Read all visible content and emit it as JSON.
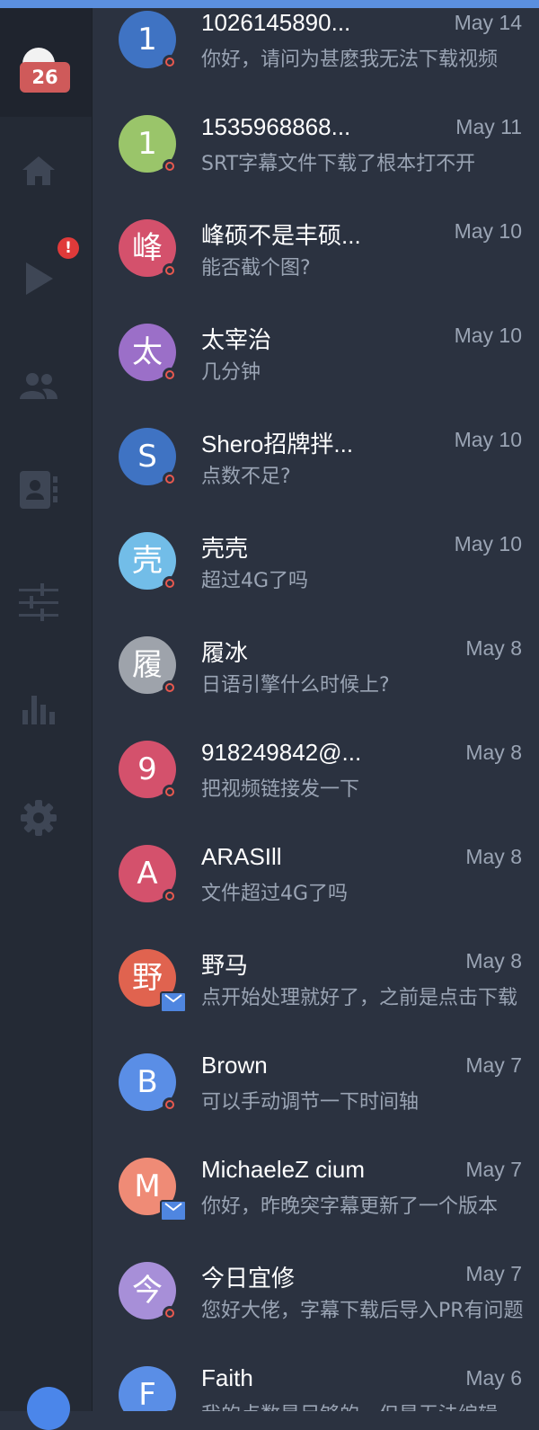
{
  "sidebar": {
    "unread_badge": "26",
    "alert_badge": "!",
    "nav_items": [
      {
        "icon": "home-icon"
      },
      {
        "icon": "play-icon"
      },
      {
        "icon": "people-icon"
      },
      {
        "icon": "contacts-icon"
      },
      {
        "icon": "sliders-icon"
      },
      {
        "icon": "bar-chart-icon"
      },
      {
        "icon": "gear-icon"
      }
    ]
  },
  "colors": {
    "accent": "#5b8fdf",
    "badge": "#cf5a5a",
    "alert": "#e03a3a",
    "status_ring": "#e8594f"
  },
  "conversations": [
    {
      "initial": "1",
      "name": "1026145890...",
      "date": "May 14",
      "message": "你好，请问为甚麽我无法下载视频",
      "avatar_color": "#3f73c3",
      "status": "ring"
    },
    {
      "initial": "1",
      "name": "1535968868...",
      "date": "May 11",
      "message": "SRT字幕文件下载了根本打不开",
      "avatar_color": "#9ac56a",
      "status": "ring"
    },
    {
      "initial": "峰",
      "name": "峰硕不是丰硕...",
      "date": "May 10",
      "message": "能否截个图?",
      "avatar_color": "#d4516c",
      "status": "ring"
    },
    {
      "initial": "太",
      "name": "太宰治",
      "date": "May 10",
      "message": "几分钟",
      "avatar_color": "#9b6fc8",
      "status": "ring"
    },
    {
      "initial": "S",
      "name": "Shero招牌拌...",
      "date": "May 10",
      "message": "点数不足?",
      "avatar_color": "#3f73c3",
      "status": "ring"
    },
    {
      "initial": "壳",
      "name": "壳壳",
      "date": "May 10",
      "message": "超过4G了吗",
      "avatar_color": "#72bde8",
      "status": "ring"
    },
    {
      "initial": "履",
      "name": "履冰",
      "date": "May 8",
      "message": "日语引擎什么时候上?",
      "avatar_color": "#9ea3ab",
      "status": "ring"
    },
    {
      "initial": "9",
      "name": "918249842@...",
      "date": "May 8",
      "message": "把视频链接发一下",
      "avatar_color": "#d4516c",
      "status": "ring"
    },
    {
      "initial": "A",
      "name": "ARASIll",
      "date": "May 8",
      "message": "文件超过4G了吗",
      "avatar_color": "#d4516c",
      "status": "ring"
    },
    {
      "initial": "野",
      "name": "野马",
      "date": "May 8",
      "message": "点开始处理就好了，之前是点击下载",
      "avatar_color": "#e0634f",
      "status": "mail"
    },
    {
      "initial": "B",
      "name": "Brown",
      "date": "May 7",
      "message": "可以手动调节一下时间轴",
      "avatar_color": "#5a8ee6",
      "status": "ring"
    },
    {
      "initial": "M",
      "name": "MichaeleZ cium",
      "date": "May 7",
      "message": "你好，昨晚突字幕更新了一个版本",
      "avatar_color": "#ef8b76",
      "status": "mail"
    },
    {
      "initial": "今",
      "name": "今日宜修",
      "date": "May 7",
      "message": "您好大佬，字幕下载后导入PR有问题",
      "avatar_color": "#a78fd8",
      "status": "ring"
    },
    {
      "initial": "F",
      "name": "Faith",
      "date": "May 6",
      "message": "我的点数是足够的，但是无法编辑",
      "avatar_color": "#5a8ee6",
      "status": "ring"
    }
  ]
}
